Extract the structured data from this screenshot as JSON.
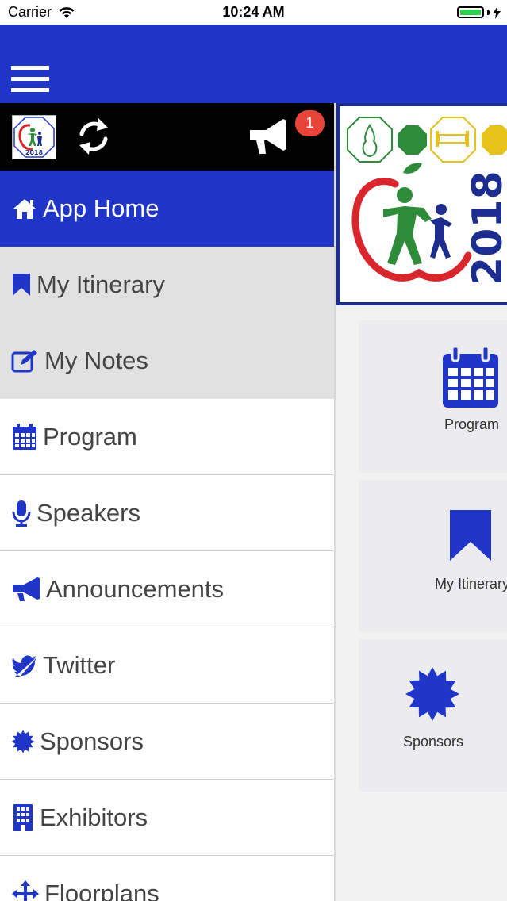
{
  "status_bar": {
    "carrier": "Carrier",
    "time": "10:24 AM"
  },
  "drawer": {
    "badge_count": "1",
    "items": [
      {
        "label": "App Home",
        "icon": "home-icon",
        "state": "active"
      },
      {
        "label": "My Itinerary",
        "icon": "bookmark-icon",
        "state": "highlighted"
      },
      {
        "label": "My Notes",
        "icon": "edit-icon",
        "state": "highlighted"
      },
      {
        "label": "Program",
        "icon": "calendar-icon",
        "state": "normal"
      },
      {
        "label": "Speakers",
        "icon": "microphone-icon",
        "state": "normal"
      },
      {
        "label": "Announcements",
        "icon": "megaphone-icon",
        "state": "normal"
      },
      {
        "label": "Twitter",
        "icon": "twitter-icon",
        "state": "normal"
      },
      {
        "label": "Sponsors",
        "icon": "starburst-icon",
        "state": "normal"
      },
      {
        "label": "Exhibitors",
        "icon": "building-icon",
        "state": "normal"
      },
      {
        "label": "Floorplans",
        "icon": "arrows-icon",
        "state": "normal"
      }
    ]
  },
  "banner": {
    "year": "2018"
  },
  "tiles": [
    {
      "label": "Program",
      "icon": "calendar-icon"
    },
    {
      "label": "My Itinerary",
      "icon": "bookmark-icon"
    },
    {
      "label": "Sponsors",
      "icon": "starburst-icon"
    }
  ],
  "colors": {
    "brand_blue": "#2036c9",
    "icon_blue": "#2036c9",
    "badge_red": "#e8443a",
    "logo_green": "#2e8b3a",
    "logo_red": "#d8262c",
    "banner_yellow": "#e6c21a",
    "battery_green": "#2bd149"
  }
}
